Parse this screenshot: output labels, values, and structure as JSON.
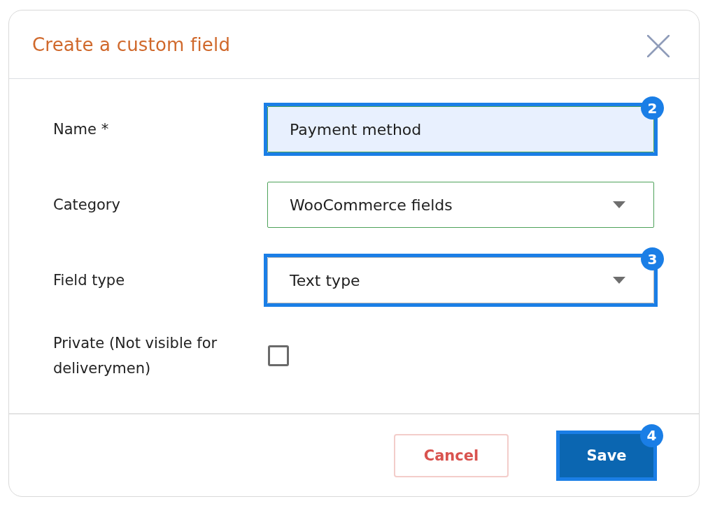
{
  "dialog": {
    "title": "Create a custom field"
  },
  "fields": [
    {
      "kind": "input",
      "label": "Name *",
      "value": "Payment method",
      "focused": true,
      "valid": true,
      "callout": "2"
    },
    {
      "kind": "select",
      "label": "Category",
      "value": "WooCommerce fields",
      "valid": true
    },
    {
      "kind": "select",
      "label": "Field type",
      "value": "Text type",
      "valid": false,
      "callout": "3"
    },
    {
      "kind": "checkbox",
      "label": "Private (Not visible for deliverymen)",
      "checked": false
    }
  ],
  "buttons": [
    {
      "kind": "secondary",
      "label": "Cancel"
    },
    {
      "kind": "primary",
      "label": "Save",
      "callout": "4"
    }
  ]
}
